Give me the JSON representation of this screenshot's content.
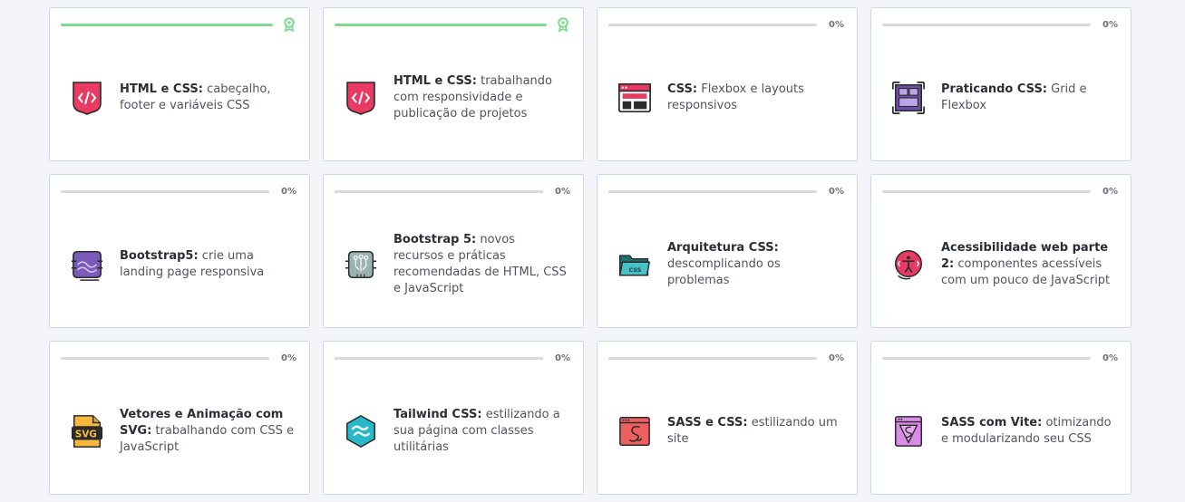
{
  "colors": {
    "progress_fill": "#7fd98e",
    "track": "#d7d9dd",
    "border": "#c9d9ea"
  },
  "courses": [
    {
      "bold": "HTML e CSS:",
      "rest": " cabeçalho, footer e variáveis CSS",
      "progress": 1.0,
      "completed": true,
      "percent_label": "",
      "icon": "html-css-icon"
    },
    {
      "bold": "HTML e CSS:",
      "rest": " trabalhando com responsividade e publicação de projetos",
      "progress": 1.0,
      "completed": true,
      "percent_label": "",
      "icon": "html-css-icon"
    },
    {
      "bold": "CSS:",
      "rest": " Flexbox e layouts responsivos",
      "progress": 0,
      "completed": false,
      "percent_label": "0%",
      "icon": "flexbox-layout-icon"
    },
    {
      "bold": "Praticando CSS:",
      "rest": " Grid e Flexbox",
      "progress": 0,
      "completed": false,
      "percent_label": "0%",
      "icon": "css-grid-icon"
    },
    {
      "bold": "Bootstrap5:",
      "rest": " crie uma landing page responsiva",
      "progress": 0,
      "completed": false,
      "percent_label": "0%",
      "icon": "bootstrap-landing-icon"
    },
    {
      "bold": "Bootstrap 5:",
      "rest": " novos recursos e práticas recomendadas de HTML, CSS e JavaScript",
      "progress": 0,
      "completed": false,
      "percent_label": "0%",
      "icon": "bootstrap-circuit-icon"
    },
    {
      "bold": "Arquitetura CSS:",
      "rest": " descomplicando os problemas",
      "progress": 0,
      "completed": false,
      "percent_label": "0%",
      "icon": "css-folder-icon"
    },
    {
      "bold": "Acessibilidade web parte 2:",
      "rest": " componentes acessíveis com um pouco de JavaScript",
      "progress": 0,
      "completed": false,
      "percent_label": "0%",
      "icon": "accessibility-icon"
    },
    {
      "bold": "Vetores e Animação com SVG:",
      "rest": " trabalhando com CSS e JavaScript",
      "progress": 0,
      "completed": false,
      "percent_label": "0%",
      "icon": "svg-file-icon"
    },
    {
      "bold": "Tailwind CSS:",
      "rest": " estilizando a sua página com classes utilitárias",
      "progress": 0,
      "completed": false,
      "percent_label": "0%",
      "icon": "tailwind-icon"
    },
    {
      "bold": "SASS e CSS:",
      "rest": " estilizando um site",
      "progress": 0,
      "completed": false,
      "percent_label": "0%",
      "icon": "sass-window-icon"
    },
    {
      "bold": "SASS com Vite:",
      "rest": " otimizando e modularizando seu CSS",
      "progress": 0,
      "completed": false,
      "percent_label": "0%",
      "icon": "sass-vite-icon"
    }
  ]
}
